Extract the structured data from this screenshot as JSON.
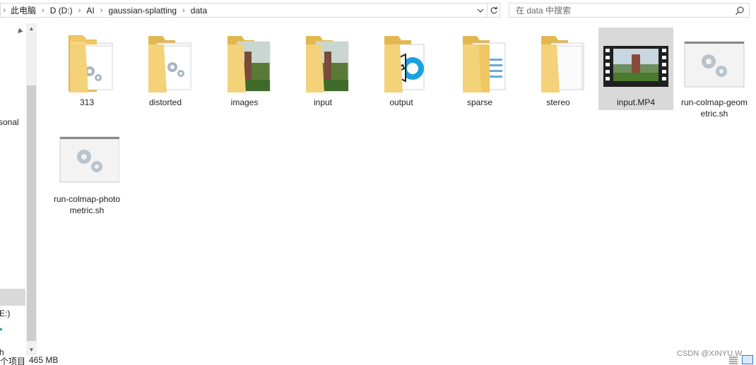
{
  "breadcrumb": {
    "segments": [
      "此电脑",
      "D (D:)",
      "AI",
      "gaussian-splatting",
      "data"
    ]
  },
  "search": {
    "placeholder": "在 data 中搜索"
  },
  "nav": {
    "items": [
      "sonal",
      "E:)",
      "h"
    ]
  },
  "items": [
    {
      "name": "313",
      "type": "folder-settings"
    },
    {
      "name": "distorted",
      "type": "folder-settings"
    },
    {
      "name": "images",
      "type": "folder-photos"
    },
    {
      "name": "input",
      "type": "folder-photos"
    },
    {
      "name": "output",
      "type": "folder-output"
    },
    {
      "name": "sparse",
      "type": "folder-docs"
    },
    {
      "name": "stereo",
      "type": "folder-docs"
    },
    {
      "name": "input.MP4",
      "type": "video",
      "selected": true
    },
    {
      "name": "run-colmap-geometric.sh",
      "type": "shell-script"
    },
    {
      "name": "run-colmap-photometric.sh",
      "type": "shell-script"
    }
  ],
  "status": {
    "count": "个项目",
    "size": "465 MB"
  },
  "watermark": "CSDN @XINYU.W",
  "colors": {
    "selection": "#d9d9d9",
    "folder": "#f4d27a",
    "folder_dark": "#e3b74f"
  }
}
